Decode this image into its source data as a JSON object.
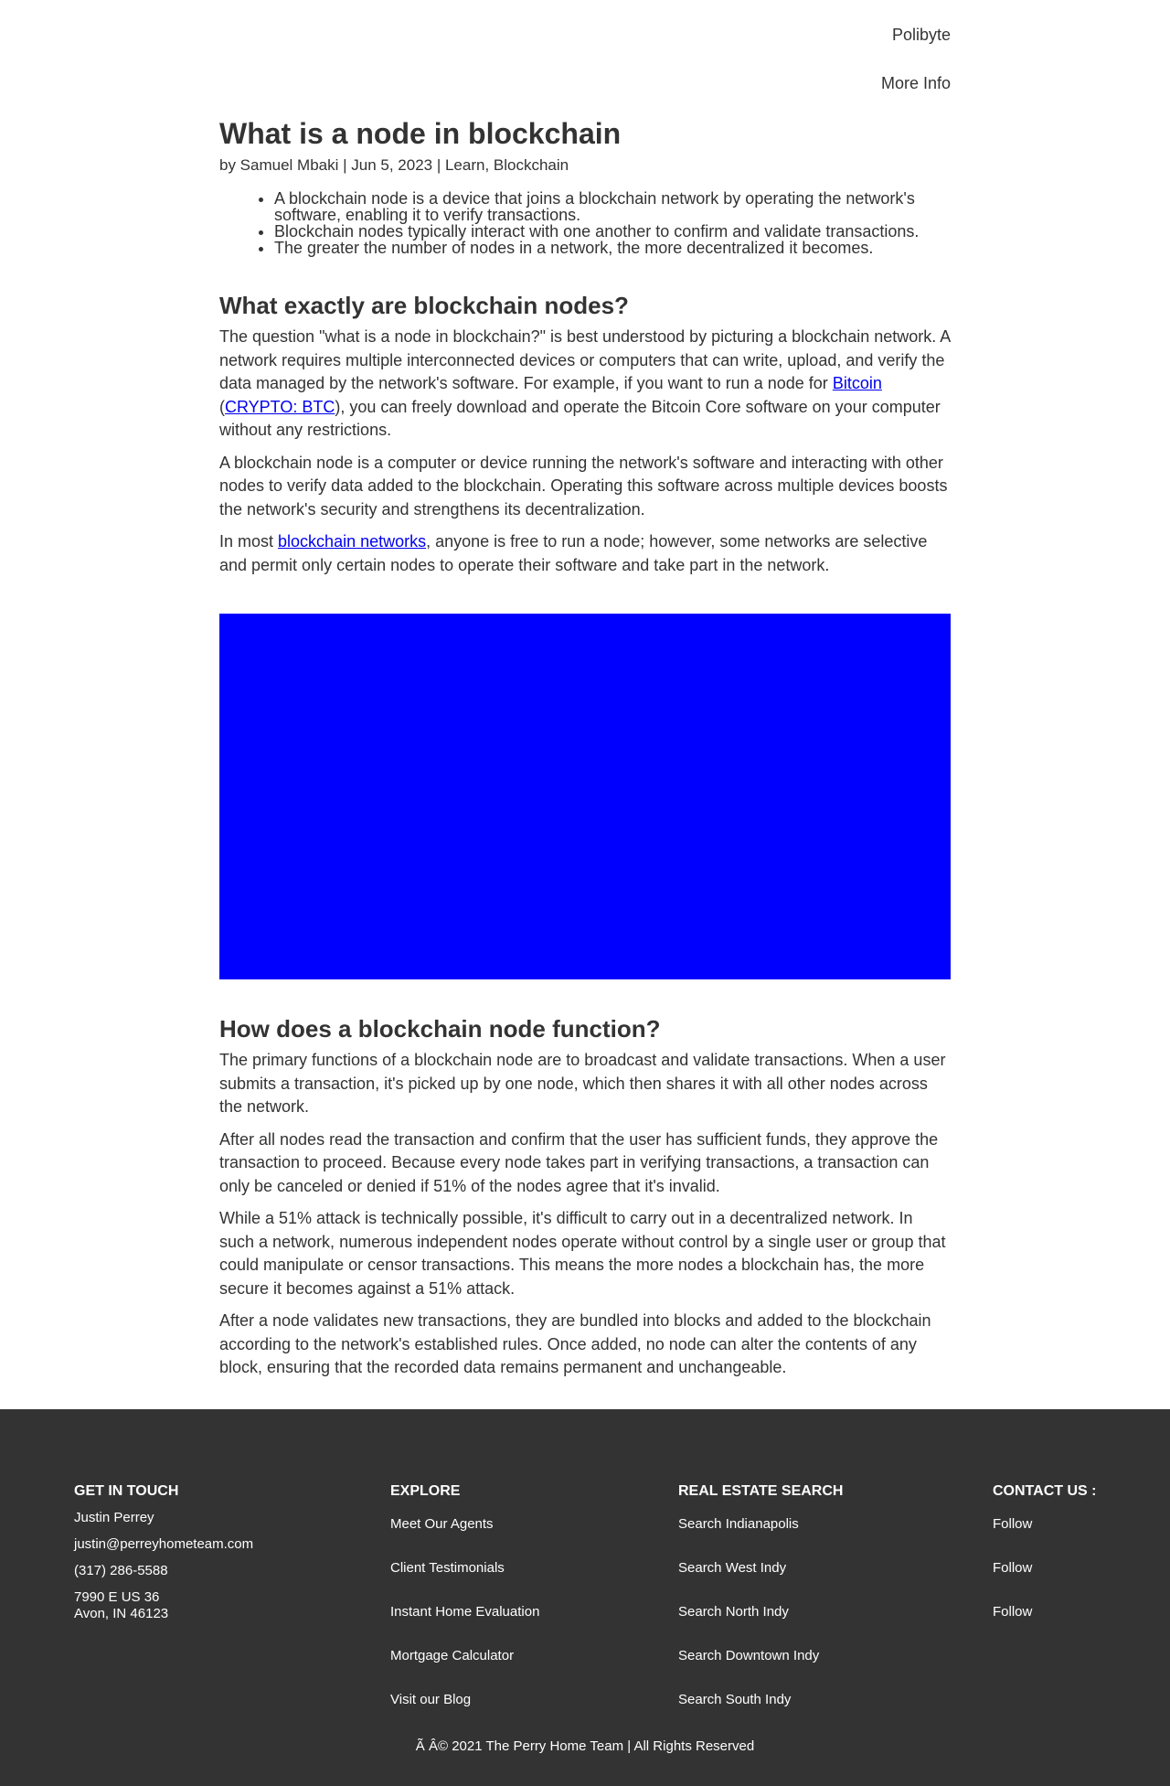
{
  "nav": {
    "brand": "Polibyte",
    "more": "More Info"
  },
  "article": {
    "title": "What is a node in blockchain",
    "meta": "by Samuel Mbaki | Jun 5, 2023 | Learn, Blockchain",
    "bullets": [
      "A blockchain node is a device that joins a blockchain network by operating the network's software, enabling it to verify transactions.",
      "Blockchain nodes typically interact with one another to confirm and validate transactions.",
      "The greater the number of nodes in a network, the more decentralized it becomes."
    ],
    "h2a": "What exactly are blockchain nodes?",
    "p1a": "The question \"what is a node in blockchain?\" is best understood by picturing a blockchain network. A network requires multiple interconnected devices or computers that can write, upload, and verify the data managed by the network's software. For example, if you want to run a node for ",
    "p1link1": "Bitcoin",
    "p1b": " (",
    "p1link2": "CRYPTO: BTC",
    "p1c": "), you can freely download and operate the Bitcoin Core software on your computer without any restrictions.",
    "p2": "A blockchain node is a computer or device running the network's software and interacting with other nodes to verify data added to the blockchain. Operating this software across multiple devices boosts the network's security and strengthens its decentralization.",
    "p3a": "In most ",
    "p3link": "blockchain networks",
    "p3b": ", anyone is free to run a node; however, some networks are selective and permit only certain nodes to operate their software and take part in the network.",
    "image_color": "#0000ff",
    "h2b": "How does a blockchain node function?",
    "p4": "The primary functions of a blockchain node are to broadcast and validate transactions. When a user submits a transaction, it's picked up by one node, which then shares it with all other nodes across the network.",
    "p5": "After all nodes read the transaction and confirm that the user has sufficient funds, they approve the transaction to proceed. Because every node takes part in verifying transactions, a transaction can only be canceled or denied if 51% of the nodes agree that it's invalid.",
    "p6": "While a 51% attack is technically possible, it's difficult to carry out in a decentralized network. In such a network, numerous independent nodes operate without control by a single user or group that could manipulate or censor transactions. This means the more nodes a blockchain has, the more secure it becomes against a 51% attack.",
    "p7": "After a node validates new transactions, they are bundled into blocks and added to the blockchain according to the network's established rules. Once added, no node can alter the contents of any block, ensuring that the recorded data remains permanent and unchangeable."
  },
  "footer": {
    "touch": {
      "title": "GET IN TOUCH",
      "name": "Justin Perrey",
      "email": "justin@perreyhometeam.com",
      "phone": "(317) 286-5588",
      "addr1": "7990 E US 36",
      "addr2": "Avon, IN 46123"
    },
    "explore": {
      "title": "EXPLORE",
      "items": [
        "Meet Our Agents",
        "Client Testimonials",
        "Instant Home Evaluation",
        "Mortgage Calculator",
        "Visit our Blog"
      ]
    },
    "search": {
      "title": "REAL ESTATE SEARCH",
      "items": [
        "Search Indianapolis",
        "Search West Indy",
        "Search North Indy",
        "Search Downtown Indy",
        "Search South Indy"
      ]
    },
    "contact": {
      "title": "CONTACT US :",
      "items": [
        "Follow",
        "Follow",
        "Follow"
      ]
    },
    "copyright": "Ã   Â© 2021 The Perry Home Team | All Rights Reserved"
  }
}
